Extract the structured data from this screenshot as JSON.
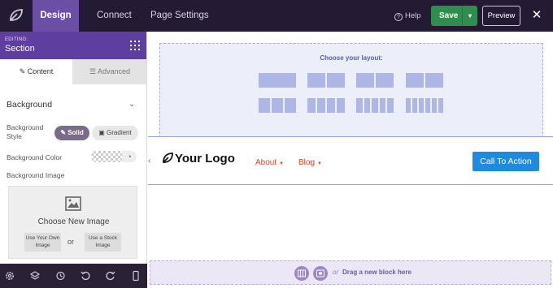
{
  "topbar": {
    "tabs": [
      "Design",
      "Connect",
      "Page Settings"
    ],
    "help": "Help",
    "save": "Save",
    "preview": "Preview"
  },
  "sidebar": {
    "editing_label": "EDITING:",
    "editing_title": "Section",
    "subtabs": [
      "Content",
      "Advanced"
    ],
    "section_title": "Background",
    "style_label": "Background Style",
    "style_options": [
      "Solid",
      "Gradient"
    ],
    "style_selected": "Solid",
    "color_label": "Background Color",
    "image_label": "Background Image",
    "choose_image": "Choose New Image",
    "own_image": "Use Your Own Image",
    "or": "or",
    "stock_image": "Use a Stock Image"
  },
  "canvas": {
    "layout_title": "Choose your layout:",
    "logo_text": "Your Logo",
    "nav": [
      "About",
      "Blog"
    ],
    "cta": "Call To Action",
    "drop_or": "or",
    "drop_text": "Drag a new block here"
  },
  "colors": {
    "topbar": "#241a33",
    "accent": "#5e3fa0",
    "save": "#2d8e4d",
    "cta": "#1e8ae0",
    "nav_link": "#e2432b"
  }
}
